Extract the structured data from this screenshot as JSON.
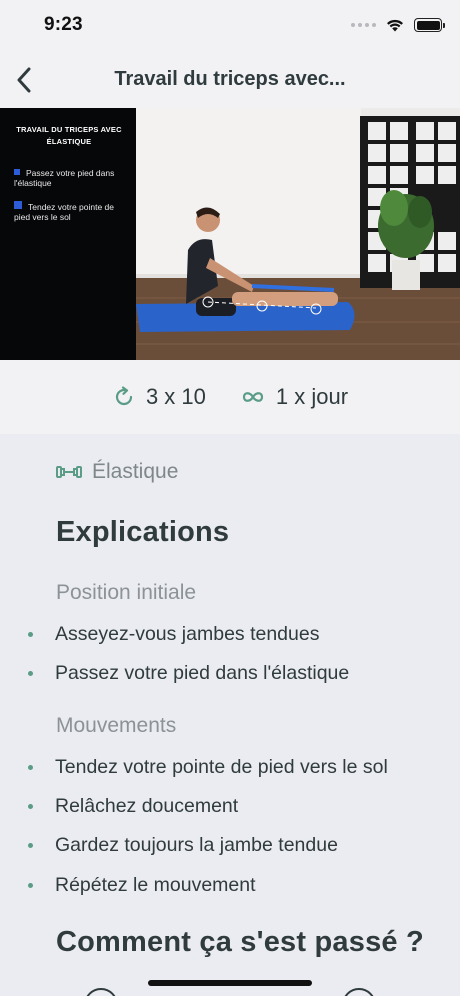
{
  "status_bar": {
    "time": "9:23"
  },
  "nav": {
    "title": "Travail du triceps avec..."
  },
  "video": {
    "title": "Travail du triceps avec élastique",
    "steps": [
      "Passez votre pied dans l'élastique",
      "Tendez votre pointe de pied vers le sol"
    ]
  },
  "stats": {
    "sets": "3 x 10",
    "frequency": "1 x jour"
  },
  "equipment": {
    "label": "Élastique"
  },
  "explications": {
    "title": "Explications",
    "initial_heading": "Position initiale",
    "initial_items": [
      "Asseyez-vous jambes tendues",
      "Passez votre pied dans l'élastique"
    ],
    "movements_heading": "Mouvements",
    "movement_items": [
      "Tendez votre pointe de pied vers le sol",
      "Relâchez doucement",
      "Gardez toujours la jambe tendue",
      "Répétez le mouvement"
    ]
  },
  "feedback": {
    "title": "Comment ça s'est passé ?"
  },
  "colors": {
    "accent": "#5a9c86",
    "text": "#2f3b3d",
    "muted": "#8c9396",
    "background": "#ebecf1"
  }
}
